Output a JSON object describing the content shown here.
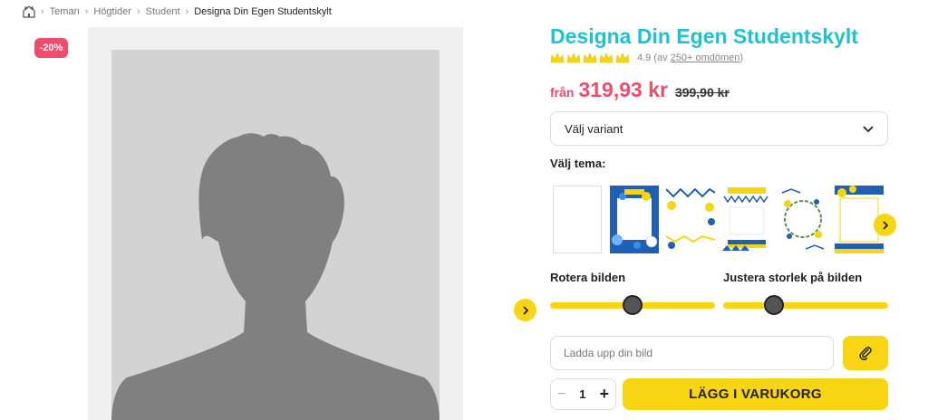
{
  "breadcrumb": {
    "items": [
      "Teman",
      "Högtider",
      "Student",
      "Designa Din Egen Studentskylt"
    ]
  },
  "badge": {
    "discount": "-20%"
  },
  "product": {
    "title": "Designa Din Egen Studentskylt",
    "rating": {
      "stars": 5,
      "score": "4.9",
      "reviews_prefix": "(av",
      "reviews_link": "250+ omdömen",
      "reviews_suffix": ")"
    },
    "price": {
      "from_label": "från",
      "current": "319,93 kr",
      "original": "399,90 kr"
    }
  },
  "variant_select": {
    "label": "Välj variant"
  },
  "theme": {
    "label": "Välj tema:",
    "thumbnails": [
      "blank",
      "blue-balloons",
      "balloons-bunting",
      "bunting-frame",
      "floral-wreath",
      "flags-corner"
    ]
  },
  "sliders": {
    "rotate": {
      "label": "Rotera bilden",
      "value": 0.5
    },
    "resize": {
      "label": "Justera storlek på bilden",
      "value": 0.31
    }
  },
  "upload": {
    "placeholder": "Ladda upp din bild"
  },
  "quantity": {
    "minus": "−",
    "value": "1",
    "plus": "+"
  },
  "cart": {
    "add_label": "LÄGG I VARUKORG"
  },
  "colors": {
    "accent_teal": "#1dc3d2",
    "sale_pink": "#f04c6b",
    "brand_yellow": "#f7d512"
  }
}
